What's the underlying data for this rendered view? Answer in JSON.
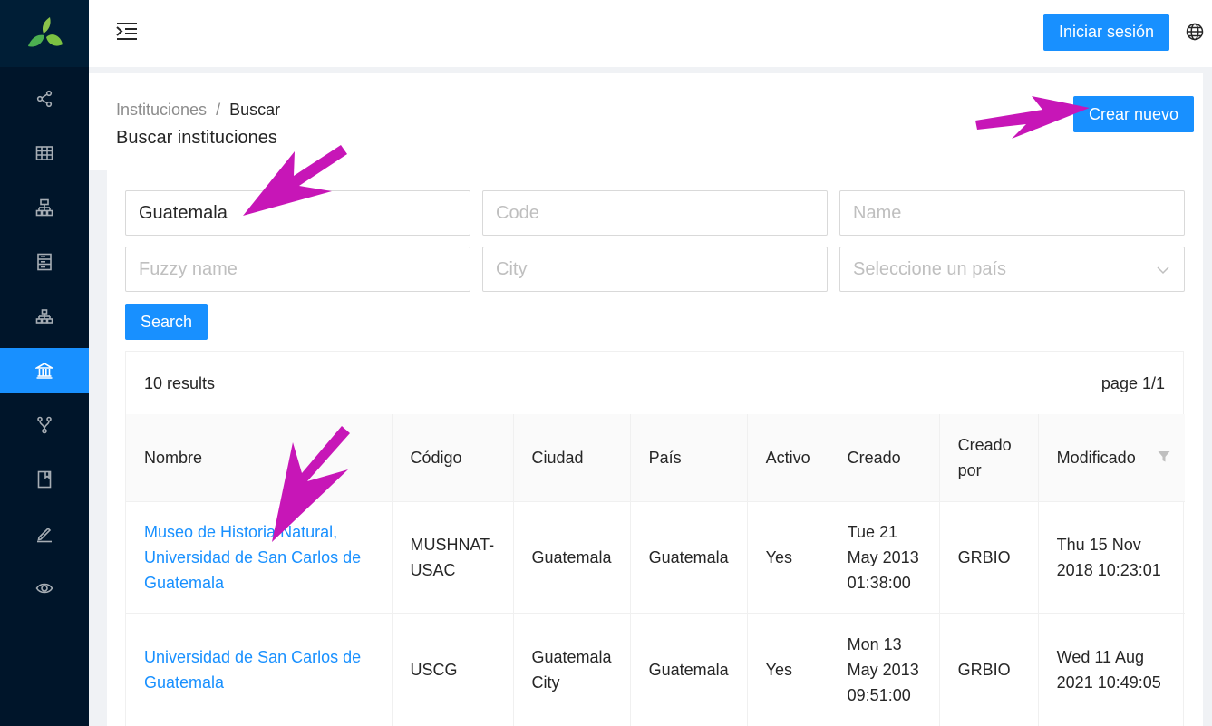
{
  "header": {
    "login_label": "Iniciar sesión"
  },
  "breadcrumb": {
    "parent": "Instituciones",
    "separator": "/",
    "current": "Buscar"
  },
  "page_title": "Buscar instituciones",
  "create_label": "Crear nuevo",
  "search_form": {
    "query_value": "Guatemala",
    "code_placeholder": "Code",
    "name_placeholder": "Name",
    "fuzzy_placeholder": "Fuzzy name",
    "city_placeholder": "City",
    "country_placeholder": "Seleccione un país",
    "search_label": "Search"
  },
  "results": {
    "count_text": "10 results",
    "page_text": "page 1/1"
  },
  "table": {
    "headers": [
      "Nombre",
      "Código",
      "Ciudad",
      "País",
      "Activo",
      "Creado",
      "Creado por",
      "Modificado"
    ],
    "rows": [
      {
        "nombre": "Museo de Historia Natural, Universidad de San Carlos de Guatemala",
        "codigo": "MUSHNAT-USAC",
        "ciudad": "Guatemala",
        "pais": "Guatemala",
        "activo": "Yes",
        "creado": "Tue 21 May 2013 01:38:00",
        "creado_por": "GRBIO",
        "modificado": "Thu 15 Nov 2018 10:23:01"
      },
      {
        "nombre": "Universidad de San Carlos de Guatemala",
        "codigo": "USCG",
        "ciudad": "Guatemala City",
        "pais": "Guatemala",
        "activo": "Yes",
        "creado": "Mon 13 May 2013 09:51:00",
        "creado_por": "GRBIO",
        "modificado": "Wed 11 Aug 2021 10:49:05"
      }
    ]
  },
  "sidebar": {
    "items": [
      {
        "icon": "share-icon"
      },
      {
        "icon": "table-icon"
      },
      {
        "icon": "hierarchy-icon"
      },
      {
        "icon": "database-icon"
      },
      {
        "icon": "org-chart-icon"
      },
      {
        "icon": "institution-icon",
        "active": true
      },
      {
        "icon": "branch-icon"
      },
      {
        "icon": "book-icon"
      },
      {
        "icon": "edit-icon"
      },
      {
        "icon": "eye-icon"
      }
    ]
  },
  "colors": {
    "primary": "#1890ff",
    "sidebar": "#00152a",
    "annotation": "#c716b7"
  }
}
